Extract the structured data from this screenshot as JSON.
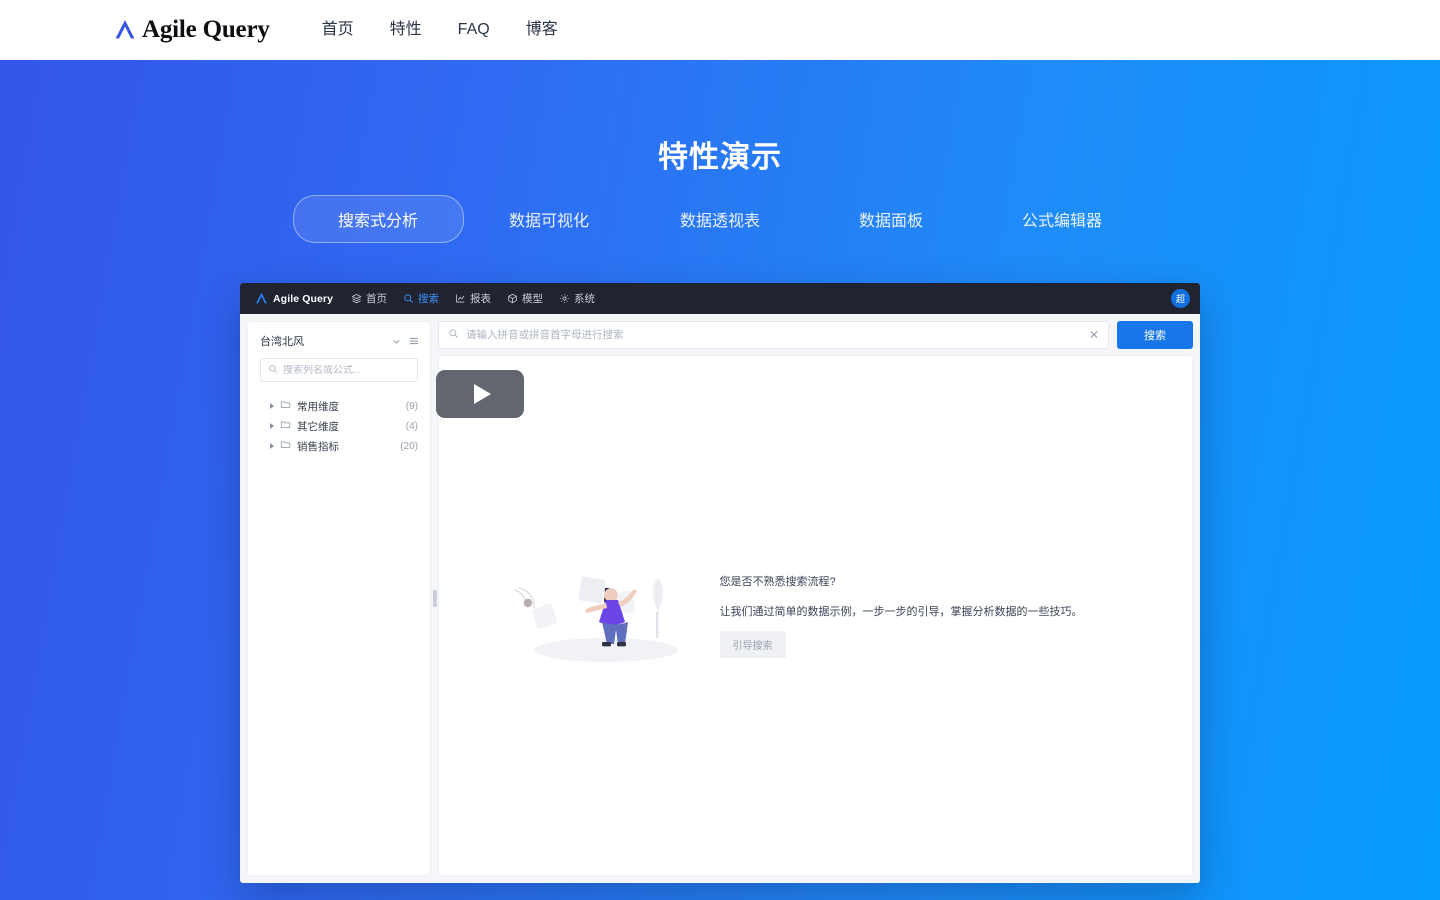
{
  "site": {
    "brand": {
      "name": "Agile Query",
      "logo_icon": "agile-query-logo-icon"
    },
    "nav": [
      {
        "label": "首页"
      },
      {
        "label": "特性"
      },
      {
        "label": "FAQ"
      },
      {
        "label": "博客"
      }
    ]
  },
  "hero": {
    "title": "特性演示",
    "gradient_from": "#3355e8",
    "gradient_to": "#069bfd",
    "tabs": [
      {
        "label": "搜索式分析",
        "active": true
      },
      {
        "label": "数据可视化",
        "active": false
      },
      {
        "label": "数据透视表",
        "active": false
      },
      {
        "label": "数据面板",
        "active": false
      },
      {
        "label": "公式编辑器",
        "active": false
      }
    ]
  },
  "app": {
    "topbar": {
      "logo_icon": "agile-query-logo-icon",
      "brand": "Agile Query",
      "nav": [
        {
          "label": "首页",
          "icon": "layers-icon",
          "active": false
        },
        {
          "label": "搜索",
          "icon": "search-icon",
          "active": true
        },
        {
          "label": "报表",
          "icon": "chart-icon",
          "active": false
        },
        {
          "label": "模型",
          "icon": "cube-icon",
          "active": false
        },
        {
          "label": "系统",
          "icon": "gear-icon",
          "active": false
        }
      ],
      "avatar_label": "超",
      "avatar_color": "#1170e0",
      "background": "#1f2430",
      "active_color": "#3f93ff"
    },
    "sidebar": {
      "dataset_name": "台湾北风",
      "dropdown_icon": "chevron-down-icon",
      "menu_icon": "hamburger-menu-icon",
      "search_placeholder": "搜索列名或公式...",
      "search_value": "",
      "search_icon": "search-icon",
      "tree": [
        {
          "label": "常用维度",
          "count": "(9)",
          "icon": "folder-icon",
          "caret": "caret-right-icon"
        },
        {
          "label": "其它维度",
          "count": "(4)",
          "icon": "folder-icon",
          "caret": "caret-right-icon"
        },
        {
          "label": "销售指标",
          "count": "(20)",
          "icon": "folder-icon",
          "caret": "caret-right-icon"
        }
      ]
    },
    "main": {
      "search_placeholder": "请输入拼音或拼音首字母进行搜索",
      "search_value": "",
      "search_icon": "search-icon",
      "clear_icon": "✕",
      "search_button": "搜索",
      "search_button_color": "#1877e8",
      "empty_state": {
        "question": "您是否不熟悉搜索流程?",
        "description": "让我们通过简单的数据示例，一步一步的引导，掌握分析数据的一些技巧。",
        "cta_label": "引导搜索",
        "illustration": "person-with-floating-cards-illustration",
        "play_icon": "play-button-icon"
      }
    }
  }
}
